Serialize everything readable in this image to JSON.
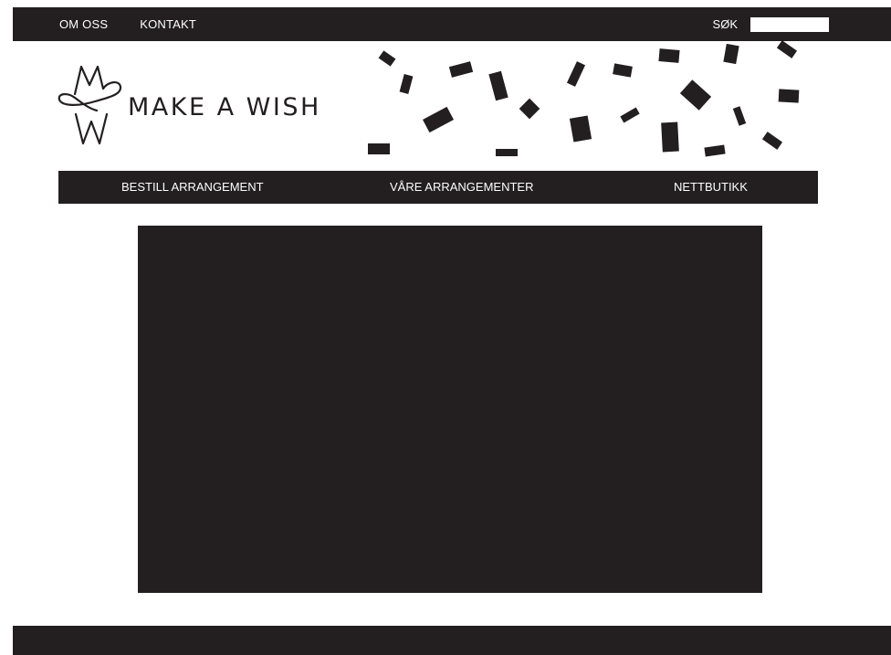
{
  "topbar": {
    "links": [
      "OM OSS",
      "KONTAKT"
    ],
    "search_label": "SØK",
    "search_value": ""
  },
  "brand": {
    "name": "MAKE A WISH",
    "logo_icon": "mw-monogram-icon"
  },
  "main_nav": {
    "items": [
      "BESTILL ARRANGEMENT",
      "VÅRE ARRANGEMENTER",
      "NETTBUTIKK"
    ]
  },
  "colors": {
    "dark": "#231f20",
    "background": "#ffffff"
  }
}
